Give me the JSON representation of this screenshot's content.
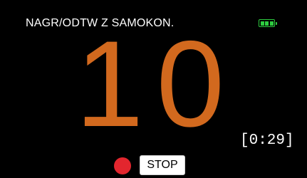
{
  "header": {
    "title": "NAGR/ODTW Z SAMOKON.",
    "battery_icon": "battery-full-icon",
    "battery_color": "#2ecc40",
    "battery_level": 1.0
  },
  "countdown": {
    "value": "10",
    "color": "#d2691e"
  },
  "remaining_time": "[0:29]",
  "controls": {
    "record_indicator_icon": "record-dot-icon",
    "record_color": "#e3262e",
    "stop_label": "STOP"
  }
}
